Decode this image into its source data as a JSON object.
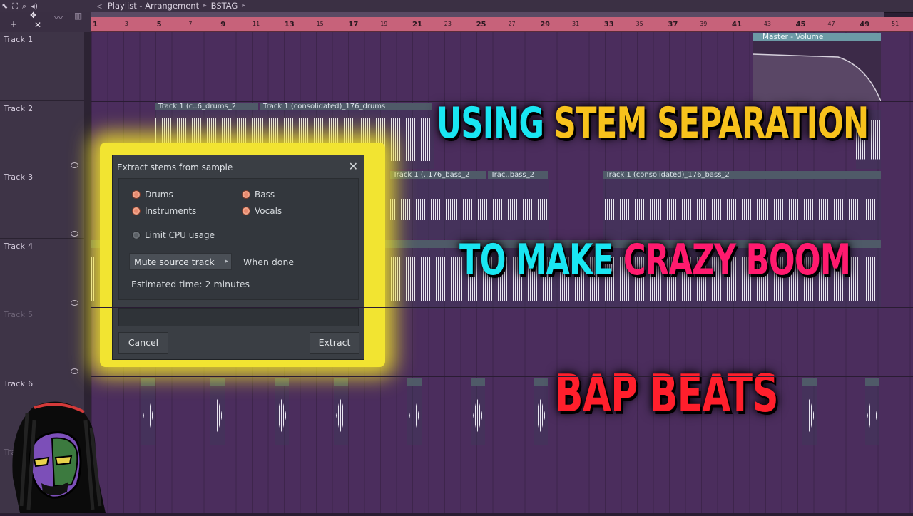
{
  "window": {
    "breadcrumb": [
      "Playlist - Arrangement",
      "BSTAG"
    ]
  },
  "ruler": {
    "ticks": [
      "1",
      "3",
      "5",
      "7",
      "9",
      "11",
      "13",
      "15",
      "17",
      "19",
      "21",
      "23",
      "25",
      "27",
      "29",
      "31",
      "33",
      "35",
      "37",
      "39",
      "41",
      "43",
      "45",
      "47",
      "49",
      "51"
    ]
  },
  "tracks": [
    {
      "label": "Track 1",
      "dim": false
    },
    {
      "label": "Track 2",
      "dim": false
    },
    {
      "label": "Track 3",
      "dim": false
    },
    {
      "label": "Track 4",
      "dim": false
    },
    {
      "label": "Track 5",
      "dim": true
    },
    {
      "label": "Track 6",
      "dim": false
    },
    {
      "label": "Track 7",
      "dim": true
    }
  ],
  "clips": {
    "master": "Master - Volume",
    "track2_a": "Track 1 (c..6_drums_2",
    "track2_b": "Track 1 (consolidated)_176_drums",
    "track3_a": "Track 1 (..176_bass_2",
    "track3_b": "Trac..bass_2",
    "track3_c": "Track 1 (consolidated)_176_bass_2"
  },
  "dialog": {
    "title": "Extract stems from sample",
    "close": "✕",
    "options": {
      "drums": "Drums",
      "bass": "Bass",
      "instruments": "Instruments",
      "vocals": "Vocals",
      "limit_cpu": "Limit CPU usage"
    },
    "mute_source": "Mute source track",
    "when_done": "When done",
    "estimated_time": "Estimated time: 2 minutes",
    "cancel": "Cancel",
    "extract": "Extract"
  },
  "headline": {
    "line1_a": "USING",
    "line1_b": "STEM SEPARATION",
    "line2_a": "TO MAKE",
    "line2_b": "CRAZY BOOM",
    "line3": "BAP BEATS"
  },
  "colors": {
    "cyan": "#19e6f2",
    "yellow": "#f7c21c",
    "pink": "#ff1a6e",
    "red": "#ff1f2c",
    "glow": "#f2e431"
  }
}
